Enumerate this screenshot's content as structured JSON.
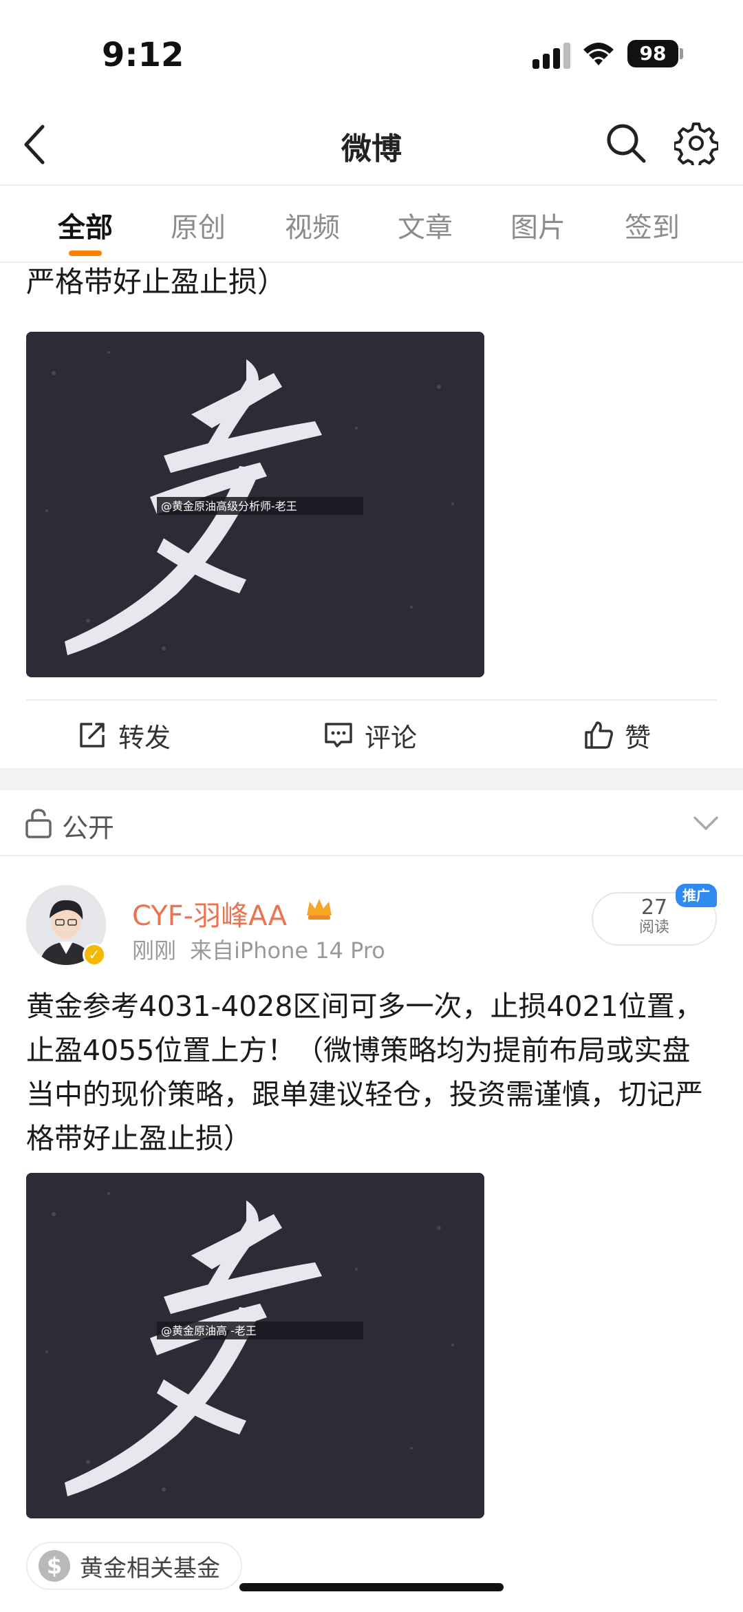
{
  "status_bar": {
    "time": "9:12",
    "battery": "98"
  },
  "nav": {
    "title": "微博"
  },
  "tabs": [
    {
      "label": "全部",
      "active": true
    },
    {
      "label": "原创"
    },
    {
      "label": "视频"
    },
    {
      "label": "文章"
    },
    {
      "label": "图片"
    },
    {
      "label": "签到"
    }
  ],
  "post1": {
    "text_tail": "严格带好止盈止损）",
    "image_watermark": "@黄金原油高级分析师-老王"
  },
  "actions": {
    "repost": "转发",
    "comment": "评论",
    "like": "赞"
  },
  "privacy": {
    "label": "公开"
  },
  "post2": {
    "username": "CYF-羽峰AA",
    "time": "刚刚",
    "source": "来自iPhone 14 Pro",
    "reads_count": "27",
    "reads_label": "阅读",
    "promo": "推广",
    "text": "黄金参考4031-4028区间可多一次，止损4021位置，止盈4055位置上方！（微博策略均为提前布局或实盘当中的现价策略，跟单建议轻仓，投资需谨慎，切记严格带好止盈止损）",
    "image_watermark": "@黄金原油高     -老王",
    "fund_chip": "黄金相关基金"
  },
  "colors": {
    "accent": "#ff8200",
    "username": "#eb7350",
    "promo": "#2f8bf0"
  }
}
